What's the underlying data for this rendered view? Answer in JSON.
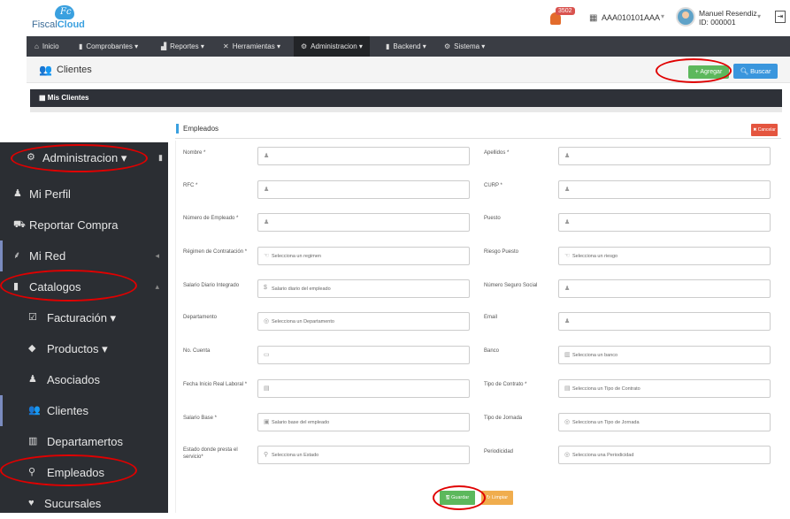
{
  "header": {
    "logo_icon": "Fc",
    "logo_text_1": "Fiscal",
    "logo_text_2": "Cloud",
    "notification_count": "3502",
    "rfc": "AAA010101AAA",
    "user_name": "Manuel Resendiz",
    "user_id": "ID: 000001"
  },
  "navbar": {
    "items": [
      {
        "icon": "home-icon",
        "label": "Inicio"
      },
      {
        "icon": "book-icon",
        "label": "Comprobantes ▾"
      },
      {
        "icon": "chart-icon",
        "label": "Reportes ▾"
      },
      {
        "icon": "tools-icon",
        "label": "Herramientas ▾"
      },
      {
        "icon": "cogs-icon",
        "label": "Administracion ▾"
      },
      {
        "icon": "book-icon",
        "label": "Backend ▾"
      },
      {
        "icon": "gears-icon",
        "label": "Sistema ▾"
      }
    ]
  },
  "page": {
    "title": "Clientes",
    "agregar_label": "+ Agregar",
    "buscar_label": "Buscar",
    "panel_title": "Mis Clientes"
  },
  "sidebar": {
    "items": [
      {
        "icon": "cogs-icon",
        "label": "Administracion ▾"
      },
      {
        "icon": "user-icon",
        "label": "Mi Perfil"
      },
      {
        "icon": "cart-icon",
        "label": "Reportar Compra"
      },
      {
        "icon": "network-icon",
        "label": "Mi Red"
      },
      {
        "icon": "book-icon",
        "label": "Catalogos"
      },
      {
        "icon": "invoice-icon",
        "label": "Facturación ▾"
      },
      {
        "icon": "tag-icon",
        "label": "Productos ▾"
      },
      {
        "icon": "user-icon",
        "label": "Asociados"
      },
      {
        "icon": "users-icon",
        "label": "Clientes"
      },
      {
        "icon": "building-icon",
        "label": "Departamertos"
      },
      {
        "icon": "employee-icon",
        "label": "Empleados"
      },
      {
        "icon": "map-pin-icon",
        "label": "Sucursales"
      }
    ]
  },
  "empleados": {
    "title": "Empleados",
    "cancelar_label": "✖ Cancelar",
    "guardar_label": "🖫 Guardar",
    "limpiar_label": "↻ Limpiar",
    "fields_left": [
      {
        "label": "Nombre *",
        "placeholder": "",
        "icon": "user-icon"
      },
      {
        "label": "RFC *",
        "placeholder": "",
        "icon": "user-icon"
      },
      {
        "label": "Número de Empleado *",
        "placeholder": "",
        "icon": "user-icon"
      },
      {
        "label": "Régimen de Contratación *",
        "placeholder": "Selecciona un regimen",
        "icon": "pointer-icon"
      },
      {
        "label": "Salario Diario Integrado",
        "placeholder": "Salario diario del empleado",
        "icon": "dollar-icon"
      },
      {
        "label": "Departamento",
        "placeholder": "Selecciona un Departamento",
        "icon": "circle-icon"
      },
      {
        "label": "No. Cuenta",
        "placeholder": "",
        "icon": "card-icon"
      },
      {
        "label": "Fecha Inicio Real Laboral *",
        "placeholder": "",
        "icon": "calendar-icon"
      },
      {
        "label": "Salario Base *",
        "placeholder": "Salario base del empleado",
        "icon": "money-icon"
      },
      {
        "label": "Estado donde presta el servicio*",
        "placeholder": "Selecciona un Estado",
        "icon": "map-pin-icon"
      }
    ],
    "fields_right": [
      {
        "label": "Apellidos *",
        "placeholder": "",
        "icon": "user-icon"
      },
      {
        "label": "CURP *",
        "placeholder": "",
        "icon": "user-icon"
      },
      {
        "label": "Puesto",
        "placeholder": "",
        "icon": "user-icon"
      },
      {
        "label": "Riesgo Puesto",
        "placeholder": "Selecciona un riesgo",
        "icon": "pointer-icon"
      },
      {
        "label": "Número Seguro Social",
        "placeholder": "",
        "icon": "user-icon"
      },
      {
        "label": "Email",
        "placeholder": "",
        "icon": "user-icon"
      },
      {
        "label": "Banco",
        "placeholder": "Selecciona un banco",
        "icon": "bank-icon"
      },
      {
        "label": "Tipo de Contrato *",
        "placeholder": "Selecciona un Tipo de Contrato",
        "icon": "doc-icon"
      },
      {
        "label": "Tipo de Jornada",
        "placeholder": "Selecciona un Tipo de Jornada",
        "icon": "circle-icon"
      },
      {
        "label": "Periodicidad",
        "placeholder": "Selecciona una Periodicidad",
        "icon": "circle-icon"
      }
    ]
  }
}
